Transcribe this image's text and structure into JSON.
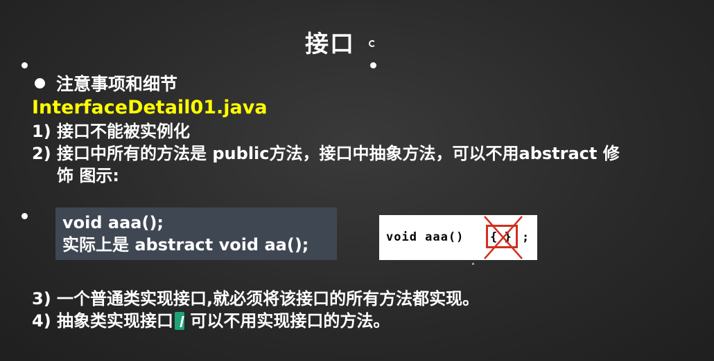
{
  "slide": {
    "title": "接口",
    "bullet_heading": "注意事项和细节",
    "file_name": "InterfaceDetail01.java",
    "points": [
      {
        "text": "1) 接口不能被实例化"
      },
      {
        "text": "2) 接口中所有的方法是 public方法，接口中抽象方法，可以不用abstract 修",
        "cont": "饰 图示:"
      },
      {
        "text": "3) 一个普通类实现接口,就必须将该接口的所有方法都实现。"
      },
      {
        "text_before_cursor": "4) 抽象类实现接口",
        "text_after_cursor": "可以不用实现接口的方法。"
      }
    ],
    "code_box": {
      "line1": "void aaa();",
      "line2": "实际上是  abstract void aa();"
    },
    "diagram": {
      "code": "void aaa()",
      "braces": "{  }",
      "semicolon": ";"
    }
  },
  "colors": {
    "background": "#2b2b2b",
    "file_name": "#ffff00",
    "code_box": "#3f4753",
    "cross": "#d0301e",
    "cursor": "#1fa37a"
  },
  "icons": [
    "rotate-handle-icon",
    "bullet-dot-icon",
    "cross-out-icon",
    "text-cursor-icon"
  ]
}
